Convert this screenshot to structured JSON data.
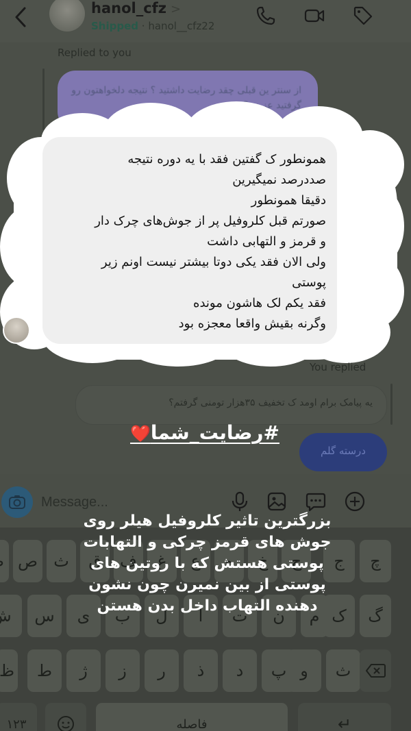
{
  "header": {
    "username": "hanol_cfz",
    "status": "Shipped",
    "separator": "·",
    "handle": "hanol__cfz22",
    "icons": [
      "back-arrow-icon",
      "phone-icon",
      "video-icon",
      "tag-icon"
    ]
  },
  "thread": {
    "replied_to_label": "Replied to you",
    "quoted_message": "از سنتر ین قبلی چقد رضایت داشتید ؟ نتیجه دلخواهتون رو گرفتید عزیزم؟",
    "message_lines": [
      "همونطور ک گفتین فقد با یه دوره نتیجه",
      "صددرصد نمیگیرین",
      "دقیقا همونطور",
      "صورتم قبل کلروفیل پر از جوش‌های چرک دار",
      "و قرمز و التهابی داشت",
      "ولی الان فقد یکی دوتا بیشتر نیست اونم زیر",
      "پوستی",
      "فقد یکم لک هاشون مونده",
      "وگرنه بقیش واقعا معجزه بود"
    ],
    "you_replied_label": "You replied",
    "quoted_reply": "یه پیامک برام اومد ک تخفیف ۳۵هزار تومنی گرفتم؟",
    "outgoing_message": "درسته گلم"
  },
  "overlay": {
    "hashtag": "#رضایت_شما",
    "heart": "❤️",
    "caption_lines": [
      "بزرگترین تاثیر کلروفیل هیلر روی",
      "جوش های قرمز چرکی و التهابات",
      "پوستی هستش که با روتین های",
      "پوستی از بین نمیرن چون نشون",
      "دهنده التهاب داخل بدن هستن"
    ]
  },
  "composer": {
    "placeholder": "Message...",
    "icons": [
      "camera-icon",
      "microphone-icon",
      "gallery-icon",
      "sticker-icon",
      "plus-circle-icon"
    ]
  },
  "keyboard": {
    "row1": [
      "ض",
      "ص",
      "ث",
      "ق",
      "ف",
      "غ",
      "ع",
      "ه",
      "خ",
      "ح",
      "ج",
      "چ"
    ],
    "row2": [
      "ش",
      "س",
      "ی",
      "ب",
      "ل",
      "ا",
      "ت",
      "ن",
      "م",
      "ک",
      "گ"
    ],
    "row3": [
      "ظ",
      "ط",
      "ژ",
      "ز",
      "ر",
      "ذ",
      "د",
      "پ",
      "و",
      "ث"
    ],
    "numbers_key": "۱۲۳",
    "space_key": "فاصله",
    "return_key": "↵"
  }
}
